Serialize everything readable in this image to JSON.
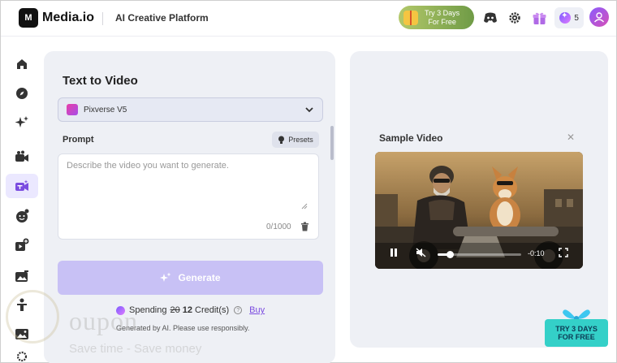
{
  "topbar": {
    "logo_text": "M",
    "brand": "Media.io",
    "platform": "AI Creative Platform",
    "promo_line1": "Try 3 Days",
    "promo_line2": "For Free",
    "credits": "5"
  },
  "sidebar": {
    "items": [
      {
        "name": "home-icon"
      },
      {
        "name": "compass-icon"
      },
      {
        "name": "sparkle-icon"
      },
      {
        "name": "image-to-video-icon"
      },
      {
        "name": "text-to-video-icon",
        "active": true
      },
      {
        "name": "face-icon"
      },
      {
        "name": "video-add-icon"
      },
      {
        "name": "image-edit-icon"
      },
      {
        "name": "person-icon"
      },
      {
        "name": "image-icon"
      }
    ]
  },
  "left_panel": {
    "title": "Text to Video",
    "model": "Pixverse V5",
    "prompt_label": "Prompt",
    "presets_label": "Presets",
    "textarea_placeholder": "Describe the video you want to generate.",
    "counter": "0/1000",
    "generate_label": "Generate",
    "spending_label": "Spending",
    "old_credits": "20",
    "new_credits": "12",
    "credits_unit": "Credit(s)",
    "buy_label": "Buy",
    "disclaimer": "Generated by AI. Please use responsibly."
  },
  "right_panel": {
    "sample_title": "Sample Video",
    "time_remaining": "-0:10",
    "progress": 0.15
  },
  "promo_corner": {
    "line1": "TRY 3 DAYS",
    "line2": "FOR FREE"
  },
  "watermark": {
    "big": "oupon",
    "small": "Save time - Save money"
  },
  "colors": {
    "accent": "#7b4ce0",
    "generate_disabled": "#c8c1f5",
    "panel_bg": "#eef0f5"
  }
}
